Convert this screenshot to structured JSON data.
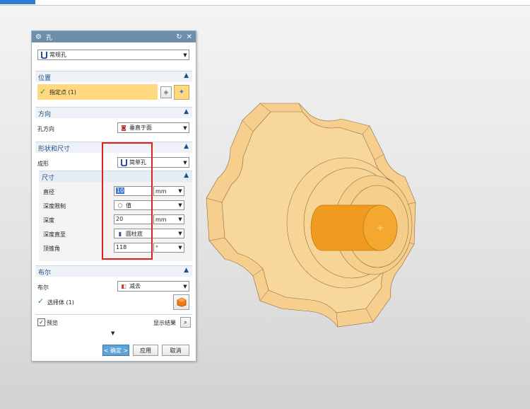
{
  "window": {
    "tab_label": "..."
  },
  "dialog": {
    "title": "孔",
    "type_value": "常规孔",
    "sections": {
      "position": {
        "label": "位置",
        "point_label": "指定点 (1)"
      },
      "direction": {
        "label": "方向",
        "hole_dir_label": "孔方向",
        "hole_dir_value": "垂直于面"
      },
      "shape": {
        "label": "形状和尺寸",
        "form_label": "成形",
        "form_value": "简单孔",
        "dims_label": "尺寸",
        "diameter_label": "直径",
        "diameter_value": "10",
        "diameter_unit": "mm",
        "depth_limit_label": "深度限制",
        "depth_limit_value": "值",
        "depth_label": "深度",
        "depth_value": "20",
        "depth_unit": "mm",
        "depth_to_label": "深度直至",
        "depth_to_value": "圆柱底",
        "tip_angle_label": "顶锥角",
        "tip_angle_value": "118",
        "tip_angle_unit": "°"
      },
      "boolean": {
        "label": "布尔",
        "bool_label": "布尔",
        "bool_value": "减去",
        "select_body_label": "选择体 (1)"
      }
    },
    "preview_label": "预览",
    "show_result_label": "显示结果",
    "buttons": {
      "ok": "< 确定 >",
      "apply": "应用",
      "cancel": "取消"
    }
  }
}
